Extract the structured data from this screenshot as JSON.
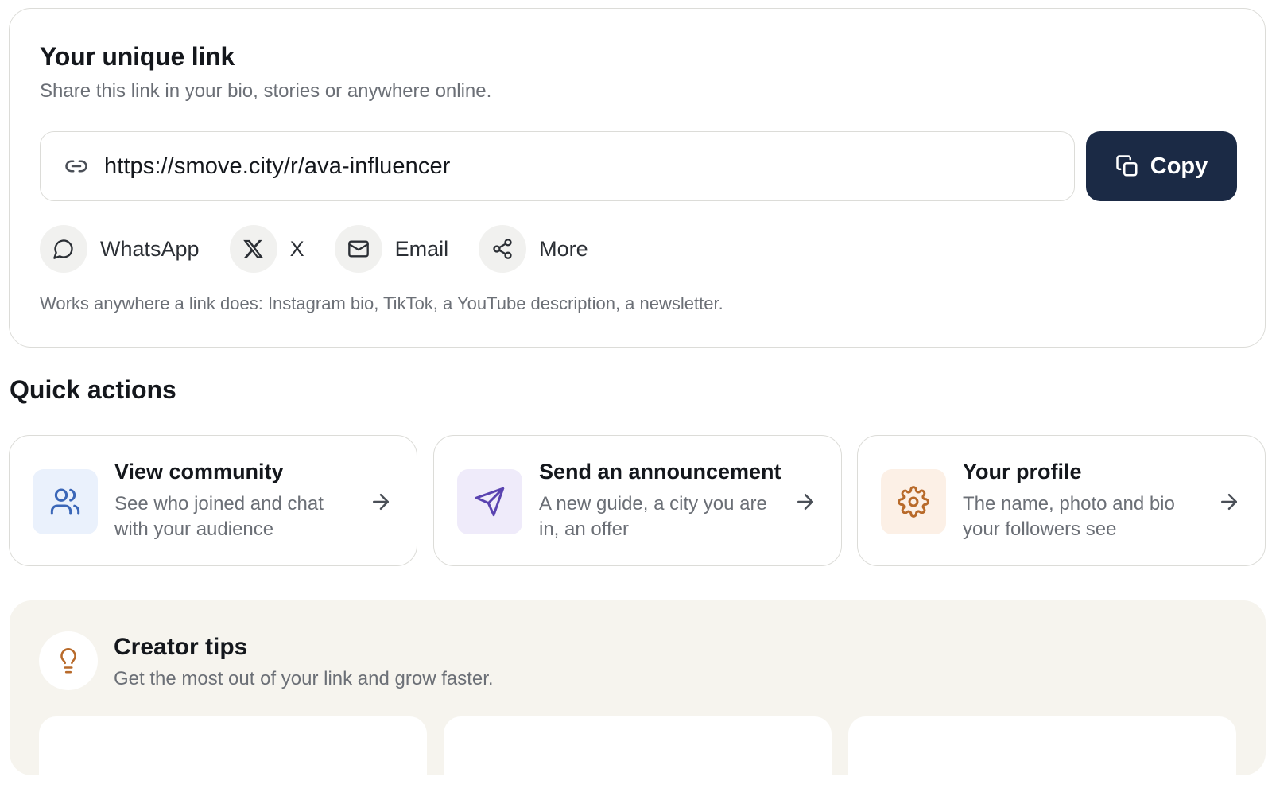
{
  "link_card": {
    "title": "Your unique link",
    "subtitle": "Share this link in your bio, stories or anywhere online.",
    "url": "https://smove.city/r/ava-influencer",
    "copy_label": "Copy",
    "share": [
      {
        "label": "WhatsApp",
        "icon": "whatsapp-icon"
      },
      {
        "label": "X",
        "icon": "x-icon"
      },
      {
        "label": "Email",
        "icon": "email-icon"
      },
      {
        "label": "More",
        "icon": "share-icon"
      }
    ],
    "note": "Works anywhere a link does: Instagram bio, TikTok, a YouTube description, a newsletter."
  },
  "quick_actions": {
    "heading": "Quick actions",
    "cards": [
      {
        "title": "View community",
        "description": "See who joined and chat with your audience",
        "icon": "users-icon",
        "icon_bg": "#eaf1fc",
        "icon_color": "#3b67b8"
      },
      {
        "title": "Send an announcement",
        "description": "A new guide, a city you are in, an offer",
        "icon": "send-icon",
        "icon_bg": "#efebfa",
        "icon_color": "#5a43b0"
      },
      {
        "title": "Your profile",
        "description": "The name, photo and bio your followers see",
        "icon": "gear-icon",
        "icon_bg": "#fcf0e6",
        "icon_color": "#b86a2a"
      }
    ]
  },
  "tips": {
    "title": "Creator tips",
    "subtitle": "Get the most out of your link and grow faster.",
    "icon": "lightbulb-icon",
    "icon_color": "#b86a2a"
  },
  "colors": {
    "primary_button": "#1b2a45",
    "border": "#dcdcd8",
    "muted_text": "#6b6f76",
    "tips_bg": "#f6f4ee"
  }
}
